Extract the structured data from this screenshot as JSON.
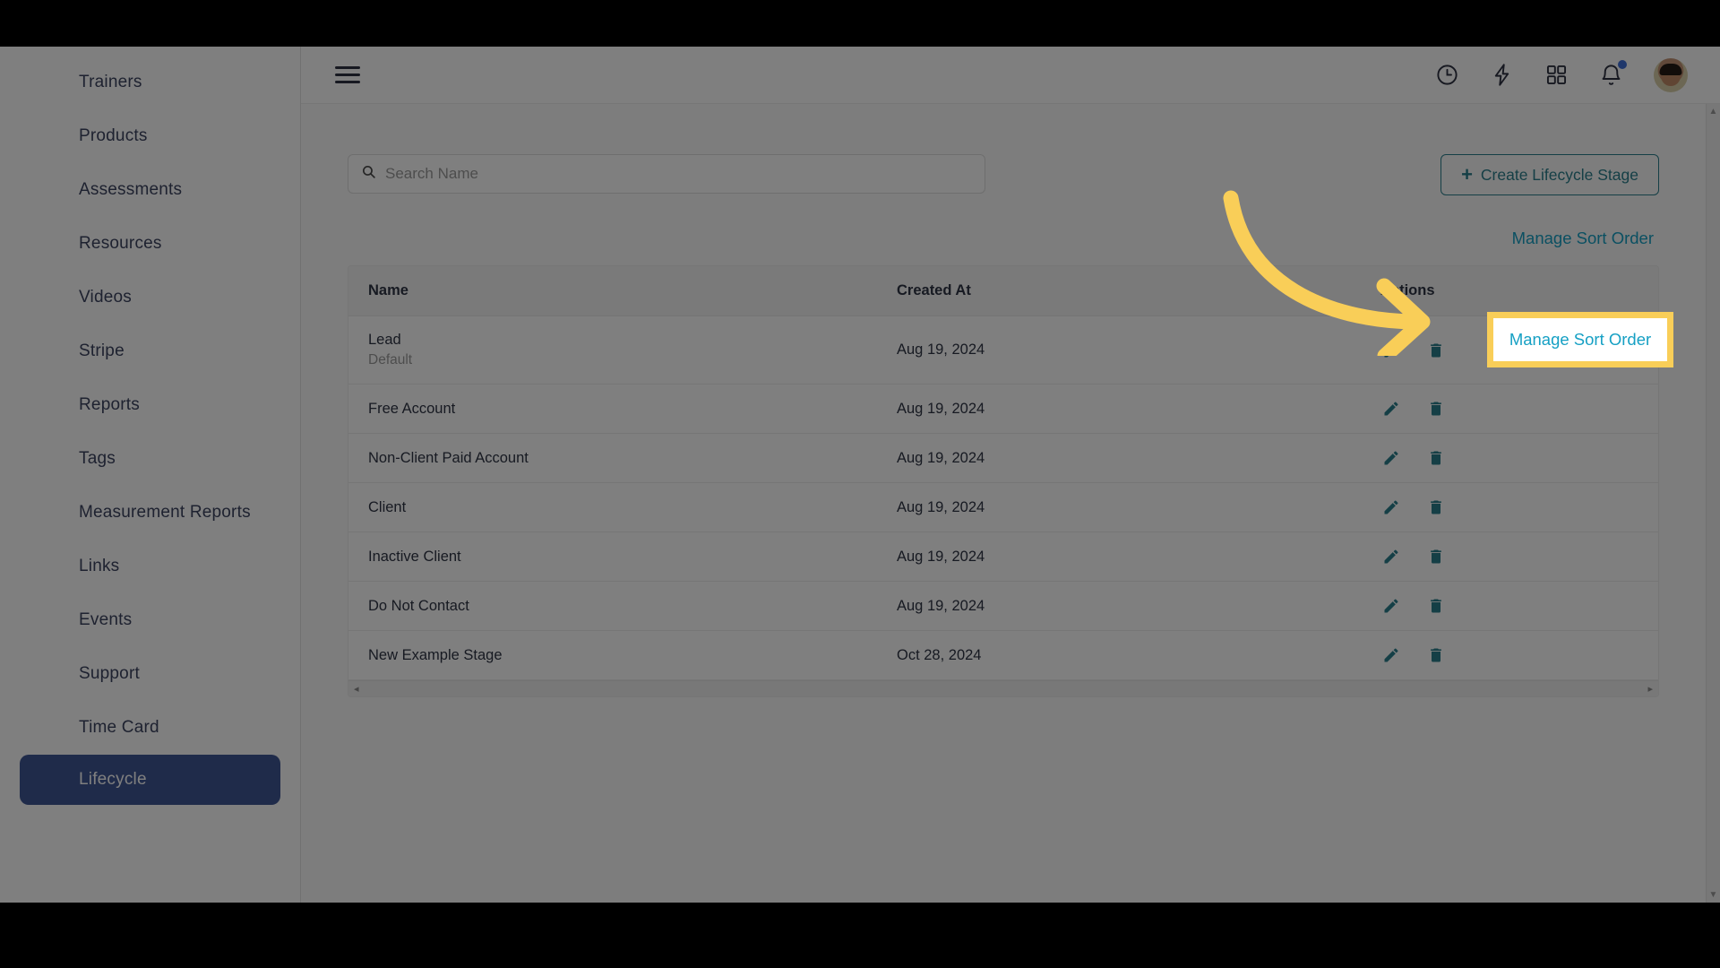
{
  "sidebar": {
    "items": [
      {
        "label": "Trainers",
        "active": false
      },
      {
        "label": "Products",
        "active": false
      },
      {
        "label": "Assessments",
        "active": false
      },
      {
        "label": "Resources",
        "active": false
      },
      {
        "label": "Videos",
        "active": false
      },
      {
        "label": "Stripe",
        "active": false
      },
      {
        "label": "Reports",
        "active": false
      },
      {
        "label": "Tags",
        "active": false
      },
      {
        "label": "Measurement Reports",
        "active": false
      },
      {
        "label": "Links",
        "active": false
      },
      {
        "label": "Events",
        "active": false
      },
      {
        "label": "Support",
        "active": false
      },
      {
        "label": "Time Card",
        "active": false
      },
      {
        "label": "Lifecycle",
        "active": true
      }
    ]
  },
  "header": {
    "menu_icon": "hamburger-icon",
    "icons": [
      {
        "name": "clock-icon",
        "badge": false
      },
      {
        "name": "lightning-bolt-icon",
        "badge": false
      },
      {
        "name": "apps-grid-icon",
        "badge": false
      },
      {
        "name": "notification-bell-icon",
        "badge": true
      }
    ],
    "avatar_alt": "user-avatar"
  },
  "toolbar": {
    "search": {
      "placeholder": "Search Name",
      "value": "",
      "icon": "search-icon"
    },
    "create_label": "Create Lifecycle Stage",
    "create_plus": "+",
    "sort_label": "Manage Sort Order"
  },
  "table": {
    "columns": [
      "Name",
      "Created At",
      "Actions"
    ],
    "rows": [
      {
        "name": "Lead",
        "sub": "Default",
        "created_at": "Aug 19, 2024",
        "actions": [
          "edit-icon",
          "delete-icon"
        ]
      },
      {
        "name": "Free Account",
        "sub": "",
        "created_at": "Aug 19, 2024",
        "actions": [
          "edit-icon",
          "delete-icon"
        ]
      },
      {
        "name": "Non-Client Paid Account",
        "sub": "",
        "created_at": "Aug 19, 2024",
        "actions": [
          "edit-icon",
          "delete-icon"
        ]
      },
      {
        "name": "Client",
        "sub": "",
        "created_at": "Aug 19, 2024",
        "actions": [
          "edit-icon",
          "delete-icon"
        ]
      },
      {
        "name": "Inactive Client",
        "sub": "",
        "created_at": "Aug 19, 2024",
        "actions": [
          "edit-icon",
          "delete-icon"
        ]
      },
      {
        "name": "Do Not Contact",
        "sub": "",
        "created_at": "Aug 19, 2024",
        "actions": [
          "edit-icon",
          "delete-icon"
        ]
      },
      {
        "name": "New Example Stage",
        "sub": "",
        "created_at": "Oct 28, 2024",
        "actions": [
          "edit-icon",
          "delete-icon"
        ]
      }
    ],
    "hscroll_left": "◂",
    "hscroll_right": "▸"
  },
  "page_scroll": {
    "up": "▲",
    "down": "▼"
  },
  "annotation": {
    "arrow": "curved-arrow-pointing-to-manage-sort-order",
    "highlight_label": "Manage Sort Order"
  },
  "colors": {
    "accent_teal": "#2a7f8c",
    "link_cyan": "#16a0c4",
    "highlight_yellow": "#f9ce58",
    "sidebar_active": "#3f5794",
    "badge_blue": "#3f6fd6"
  }
}
